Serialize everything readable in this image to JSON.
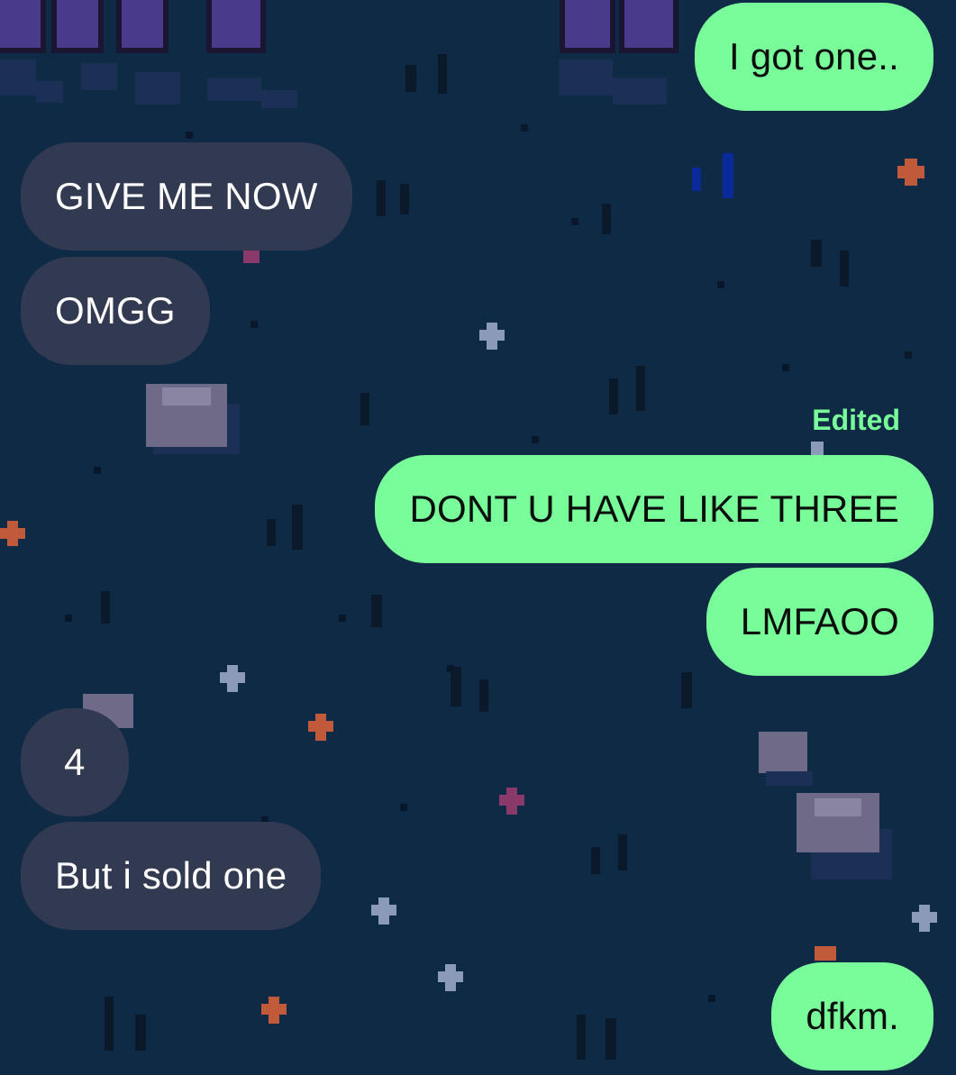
{
  "colors": {
    "background": "#0f2a44",
    "incoming_bubble": "#323a52",
    "outgoing_bubble": "#79fc9a",
    "edited_label": "#79fc9a"
  },
  "messages": [
    {
      "sender": "me",
      "text": "I got one.."
    },
    {
      "sender": "them",
      "text": "GIVE ME NOW"
    },
    {
      "sender": "them",
      "text": "OMGG"
    },
    {
      "sender": "me",
      "text": "DONT U HAVE LIKE THREE",
      "status": "Edited"
    },
    {
      "sender": "me",
      "text": "LMFAOO"
    },
    {
      "sender": "them",
      "text": "4"
    },
    {
      "sender": "them",
      "text": "But i sold one"
    },
    {
      "sender": "me",
      "text": "dfkm."
    }
  ]
}
